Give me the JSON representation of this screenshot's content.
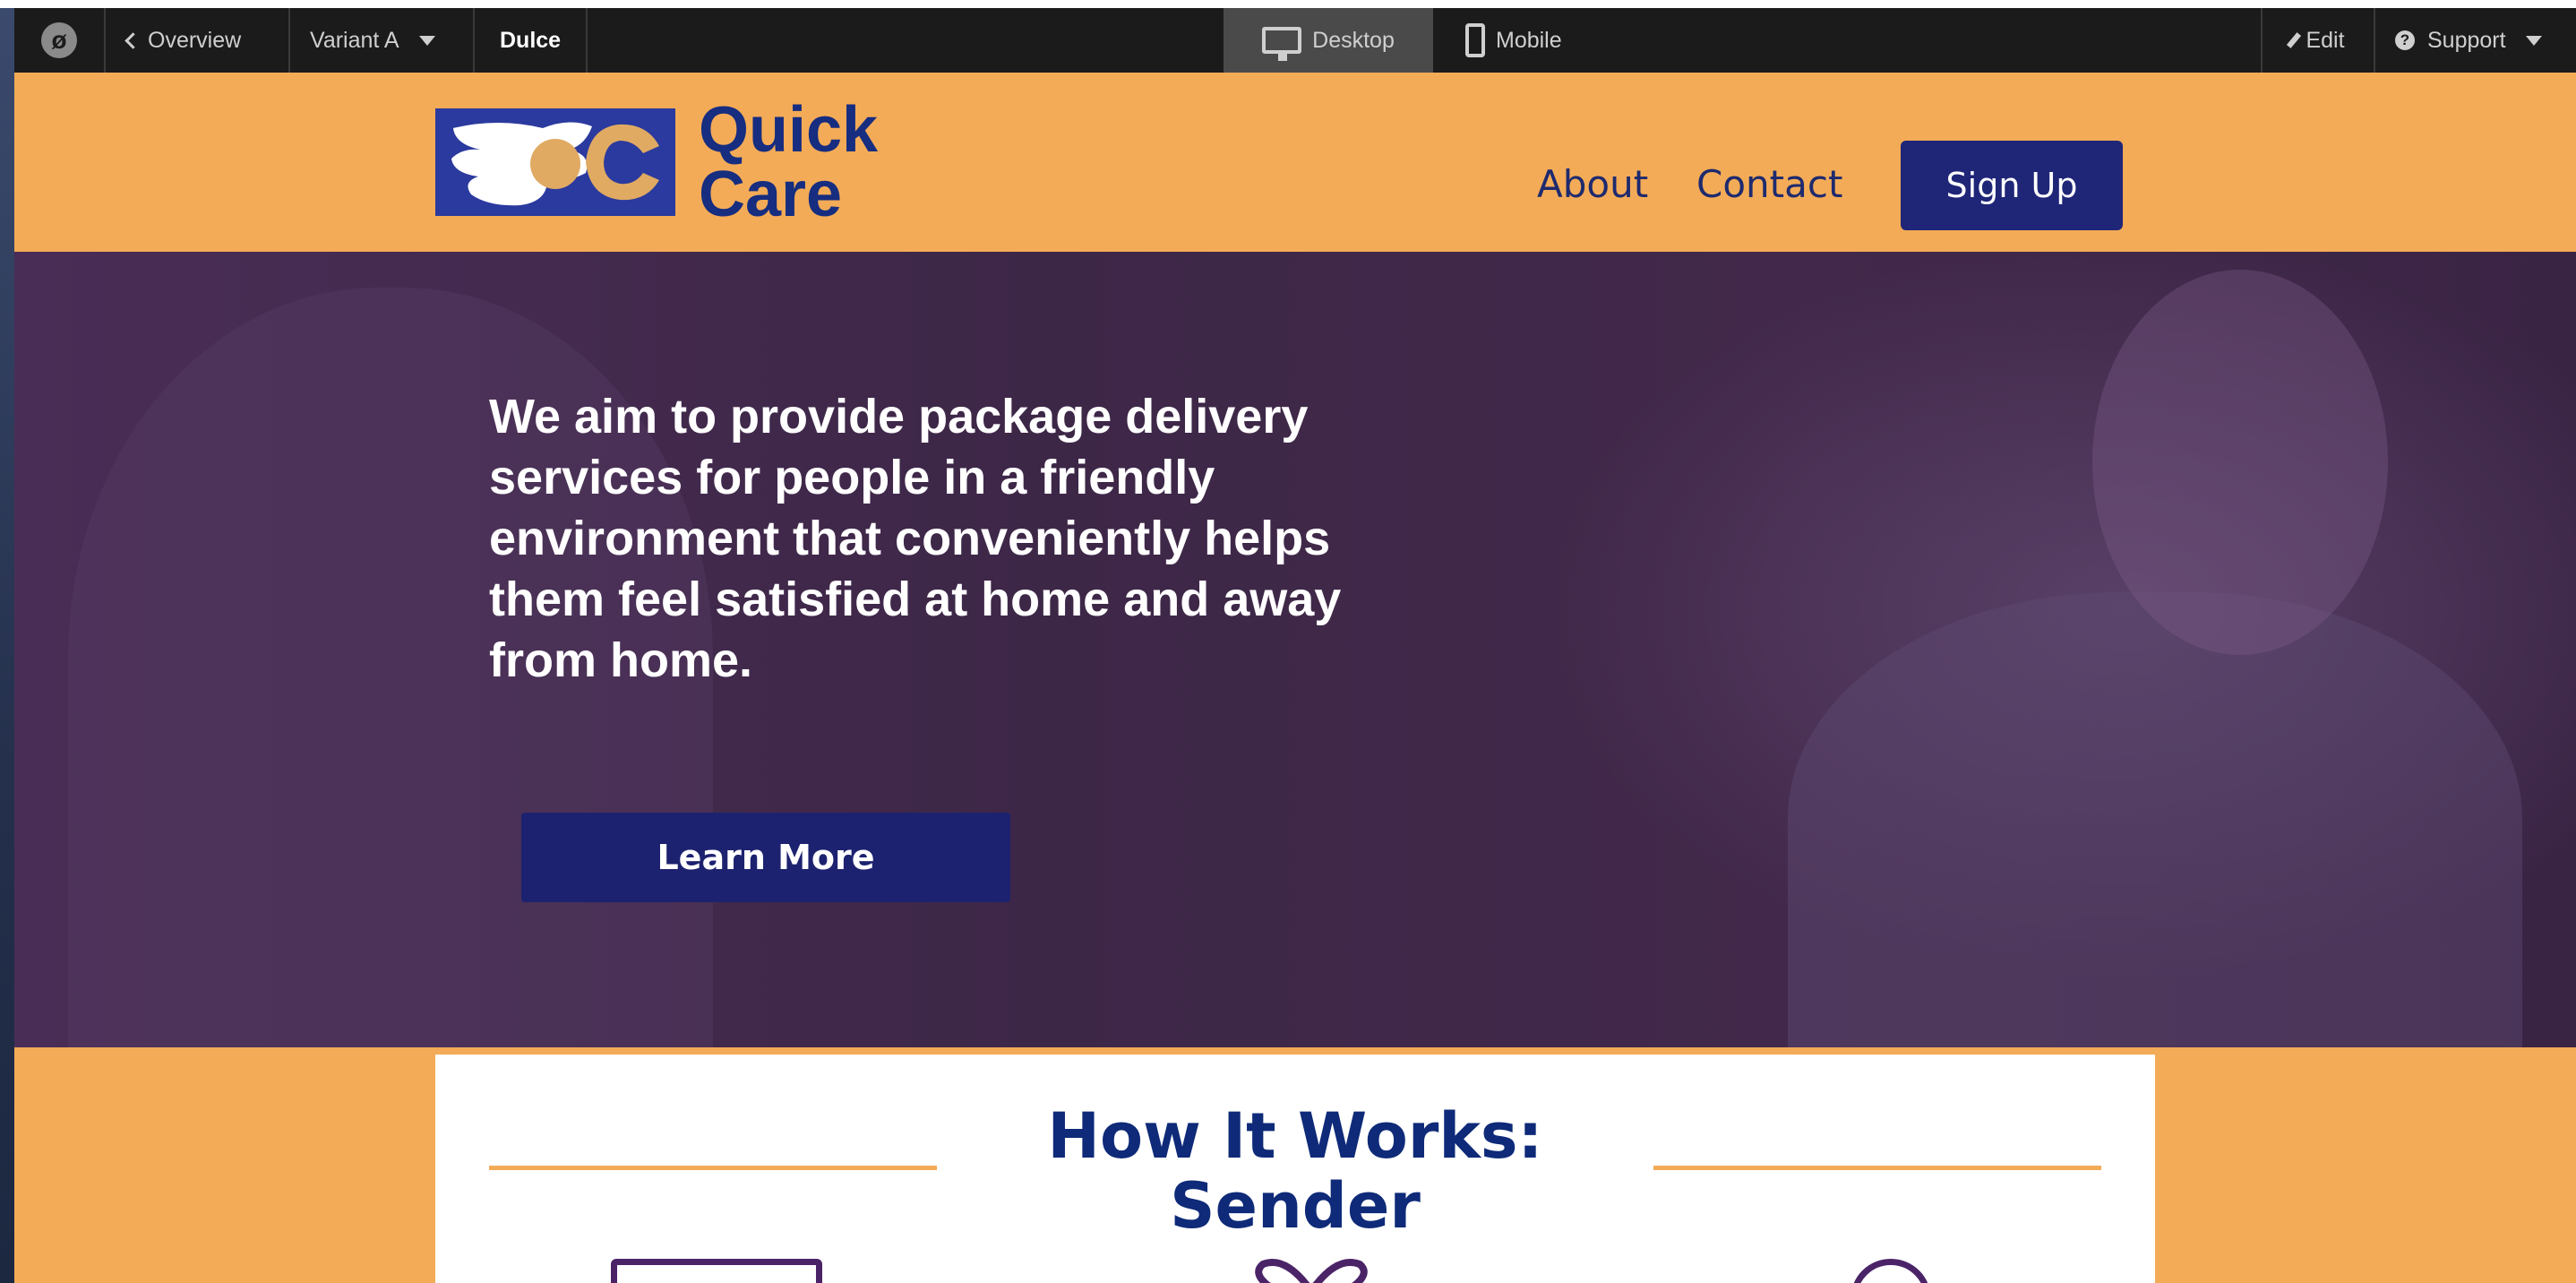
{
  "toolbar": {
    "logo_glyph": "ø",
    "overview": "Overview",
    "variant": "Variant A",
    "page_name": "Dulce",
    "desktop": "Desktop",
    "mobile": "Mobile",
    "edit": "Edit",
    "support": "Support"
  },
  "header": {
    "logo_line1": "Quick",
    "logo_line2": "Care",
    "nav": [
      "About",
      "Contact"
    ],
    "signup": "Sign Up"
  },
  "hero": {
    "text": "We aim to provide package delivery services for people in a friendly environment that conveniently helps them feel satisfied at home and away from home.",
    "cta": "Learn More"
  },
  "how_it_works": {
    "title_line1": "How It Works:",
    "title_line2": "Sender"
  },
  "colors": {
    "brand_orange": "#f3ab57",
    "brand_navy": "#1f2577",
    "hero_purple": "#42294b",
    "toolbar_dark": "#1b1b1b"
  }
}
